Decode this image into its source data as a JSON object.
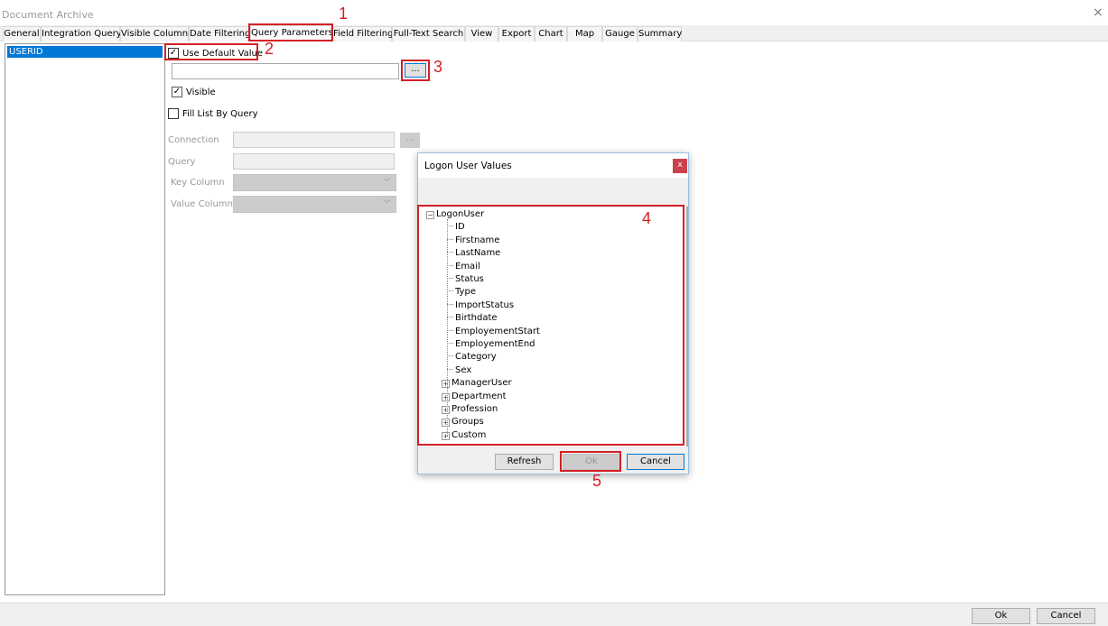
{
  "window": {
    "title": "Document Archive",
    "close": "×"
  },
  "tabs": [
    "General",
    "Integration Query",
    "Visible Columns",
    "Date Filtering",
    "Query Parameters",
    "Field Filtering",
    "Full-Text Search",
    "View",
    "Export",
    "Chart",
    "Map",
    "Gauge",
    "Summary"
  ],
  "active_tab": "Query Parameters",
  "parameters": [
    "USERID"
  ],
  "form": {
    "use_default_value": {
      "label": "Use Default Value",
      "checked": true
    },
    "default_value": "",
    "browse_label": "...",
    "visible": {
      "label": "Visible",
      "checked": true
    },
    "fill_list_by_query": {
      "label": "Fill List By Query",
      "checked": false
    },
    "connection_label": "Connection",
    "connection_browse": "...",
    "query_label": "Query",
    "key_column_label": "Key Column",
    "value_column_label": "Value Column"
  },
  "dialog": {
    "title": "Logon User Values",
    "close": "x",
    "root": "LogonUser",
    "fields": [
      "ID",
      "Firstname",
      "LastName",
      "Email",
      "Status",
      "Type",
      "ImportStatus",
      "Birthdate",
      "EmployementStart",
      "EmployementEnd",
      "Category",
      "Sex"
    ],
    "groups": [
      "ManagerUser",
      "Department",
      "Profession",
      "Groups",
      "Custom"
    ],
    "refresh": "Refresh",
    "ok": "Ok",
    "cancel": "Cancel"
  },
  "annotations": [
    "1",
    "2",
    "3",
    "4",
    "5"
  ],
  "footer": {
    "ok": "Ok",
    "cancel": "Cancel"
  },
  "colors": {
    "accent": "#0078d7",
    "annotation": "#d42026"
  }
}
